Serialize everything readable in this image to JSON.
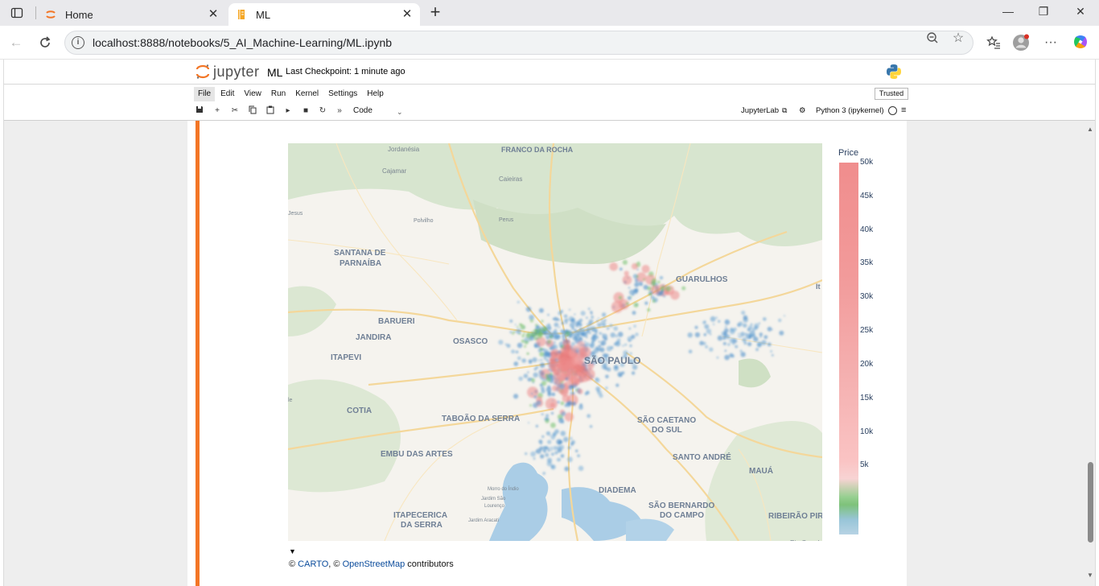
{
  "browser": {
    "tabs": [
      {
        "title": "Home",
        "icon": "jupyter-icon",
        "active": false
      },
      {
        "title": "ML",
        "icon": "notebook-icon",
        "active": true
      }
    ],
    "url": "localhost:8888/notebooks/5_AI_Machine-Learning/ML.ipynb"
  },
  "jupyter": {
    "logo_text": "jupyter",
    "notebook_name": "ML",
    "checkpoint": "Last Checkpoint: 1 minute ago",
    "trusted": "Trusted",
    "menu": [
      "File",
      "Edit",
      "View",
      "Run",
      "Kernel",
      "Settings",
      "Help"
    ],
    "cell_type": "Code",
    "jupyterlab_link": "JupyterLab",
    "kernel": "Python 3 (ipykernel)"
  },
  "map": {
    "labels": [
      "Jordanésia",
      "FRANCO DA ROCHA",
      "Cajamar",
      "Caieiras",
      "Jesus",
      "Polvilho",
      "Perus",
      "SANTANA DE",
      "PARNAÍBA",
      "GUARULHOS",
      "BARUERI",
      "JANDIRA",
      "OSASCO",
      "SÃO PAULO",
      "ITAPEVI",
      "COTIA",
      "TABOÃO DA SERRA",
      "SÃO CAETANO",
      "DO SUL",
      "EMBU DAS ARTES",
      "SANTO ANDRÉ",
      "MAUÁ",
      "Morro do Índio",
      "Jardim São",
      "Lourenço",
      "DIADEMA",
      "SÃO BERNARDO",
      "DO CAMPO",
      "ITAPECERICA",
      "DA SERRA",
      "Jardim Aracati",
      "RIBEIRÃO PIR",
      "Rio Grand",
      "It",
      "le"
    ],
    "colorbar_title": "Price",
    "colorbar_ticks": [
      "50k",
      "45k",
      "40k",
      "35k",
      "30k",
      "25k",
      "20k",
      "15k",
      "10k",
      "5k"
    ],
    "colorbar_values": [
      50000,
      45000,
      40000,
      35000,
      30000,
      25000,
      20000,
      15000,
      10000,
      5000
    ],
    "attribution_prefix": "© ",
    "attribution_carto": "CARTO",
    "attribution_mid": ", © ",
    "attribution_osm": "OpenStreetMap",
    "attribution_suffix": " contributors"
  }
}
